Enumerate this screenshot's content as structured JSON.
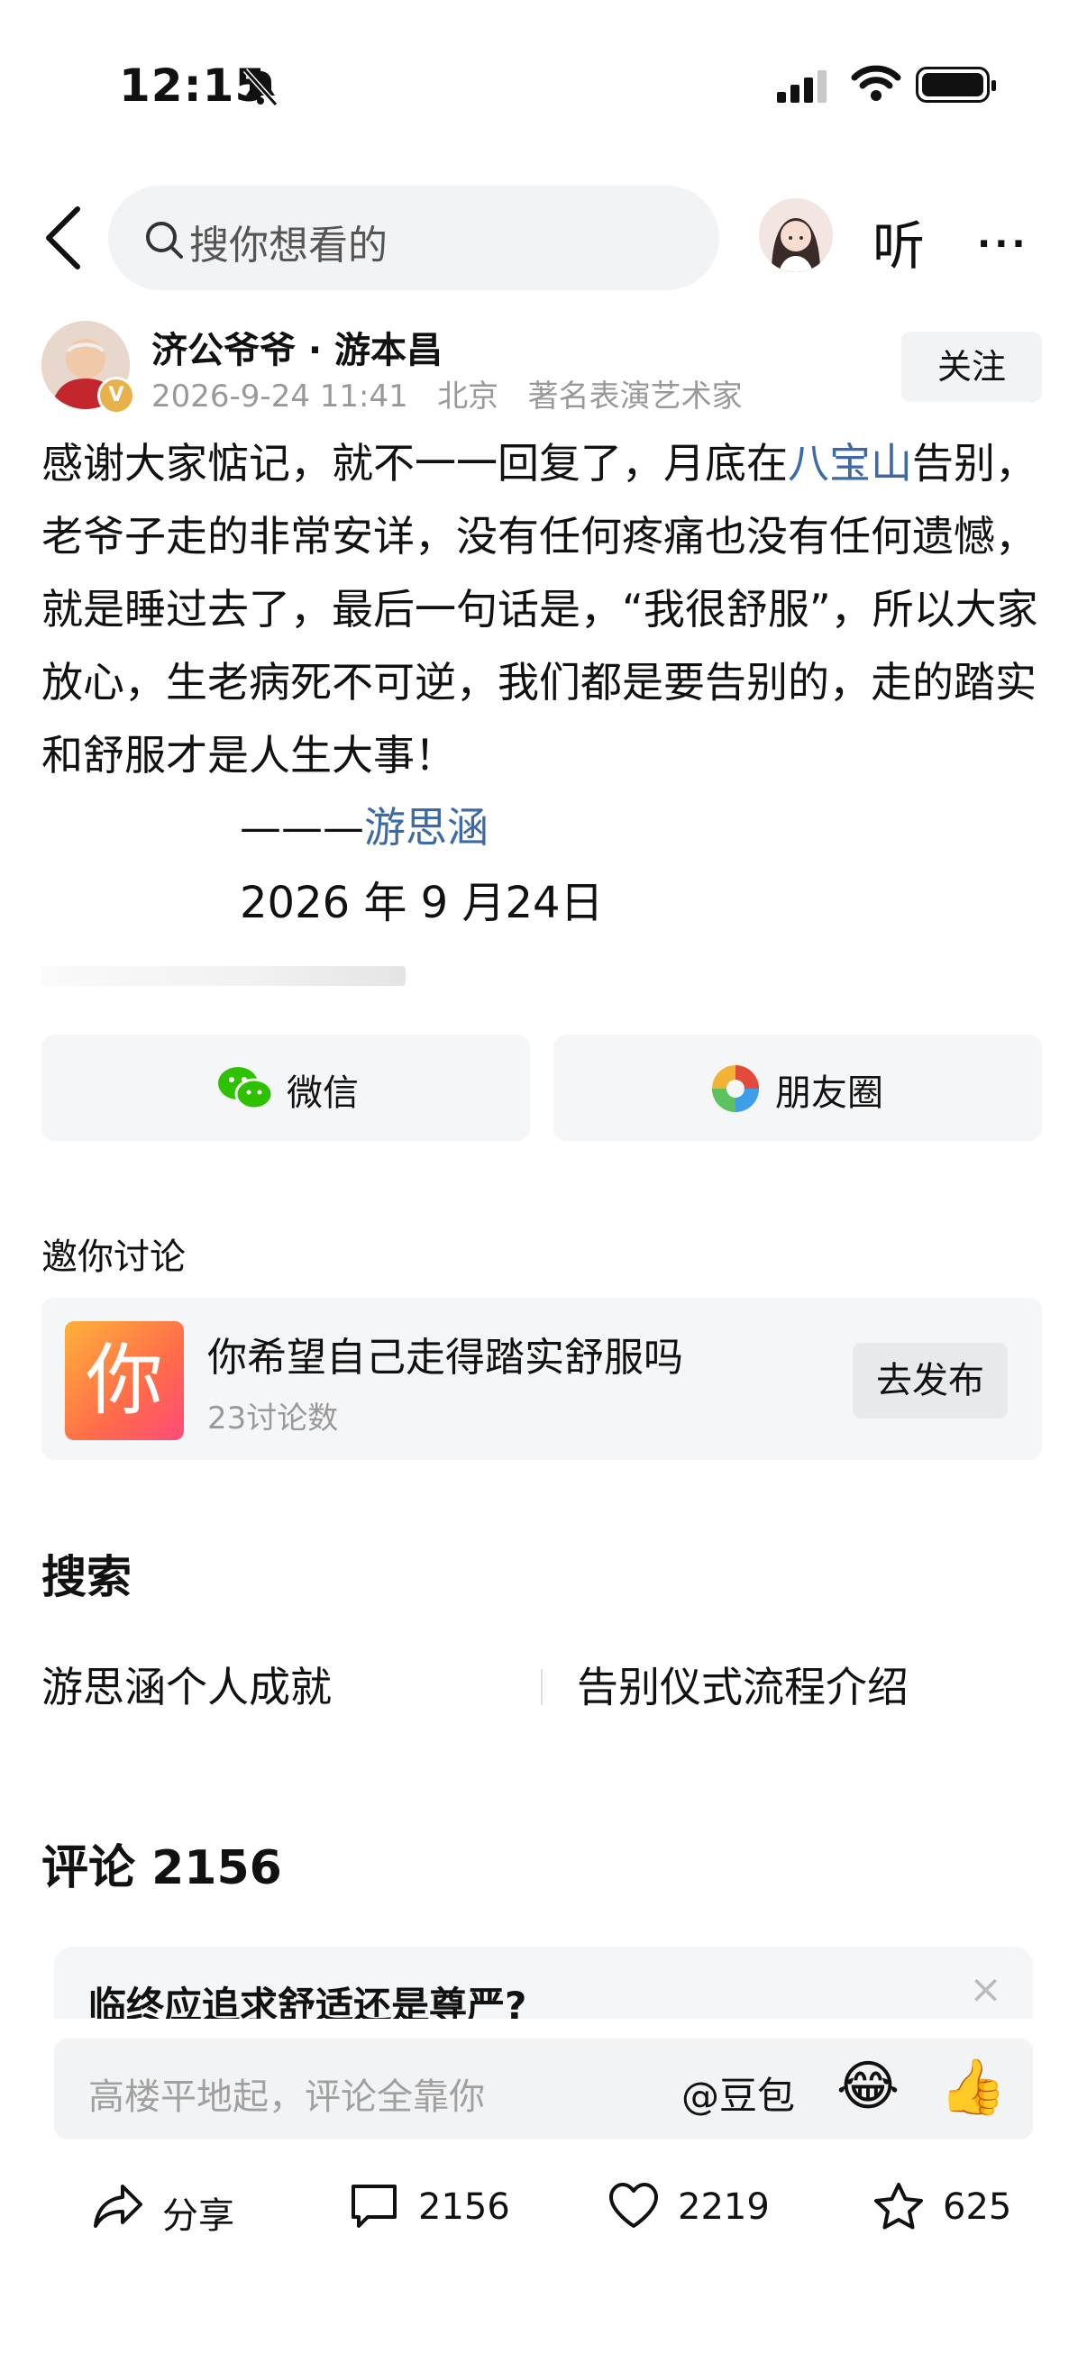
{
  "status_bar": {
    "time": "12:15"
  },
  "nav": {
    "search_placeholder": "搜你想看的",
    "listen_label": "听",
    "more_label": "···"
  },
  "author": {
    "name": "济公爷爷 · 游本昌",
    "date": "2026-9-24 11:41",
    "location": "北京",
    "title": "著名表演艺术家",
    "follow_label": "关注"
  },
  "post": {
    "text_before_link": "感谢大家惦记，就不一一回复了，月底在",
    "link_1": "八宝山",
    "text_after_link": "告别，老爷子走的非常安详，没有任何疼痛也没有任何遗憾，就是睡过去了，最后一句话是，“我很舒服”，所以大家放心，生老病死不可逆，我们都是要告别的，走的踏实和舒服才是人生大事！",
    "signature_dash": "———",
    "signature_name": "游思涵",
    "signature_date": "2026 年 9 月24日"
  },
  "share": {
    "wechat": "微信",
    "moments": "朋友圈"
  },
  "discussion": {
    "section_title": "邀你讨论",
    "icon_char": "你",
    "topic_title": "你希望自己走得踏实舒服吗",
    "topic_count": "23讨论数",
    "post_button": "去发布"
  },
  "search_section": {
    "title": "搜索",
    "suggestions": [
      "游思涵个人成就",
      "告别仪式流程介绍"
    ]
  },
  "comments": {
    "title": "评论 2156",
    "question": "临终应追求舒适还是尊严?",
    "close": "×",
    "input_placeholder": "高楼平地起，评论全靠你",
    "at_label": "@豆包",
    "emoji_1": "😂",
    "emoji_2": "👍"
  },
  "bottom_bar": {
    "share": "分享",
    "comment_count": "2156",
    "like_count": "2219",
    "favorite_count": "625"
  }
}
